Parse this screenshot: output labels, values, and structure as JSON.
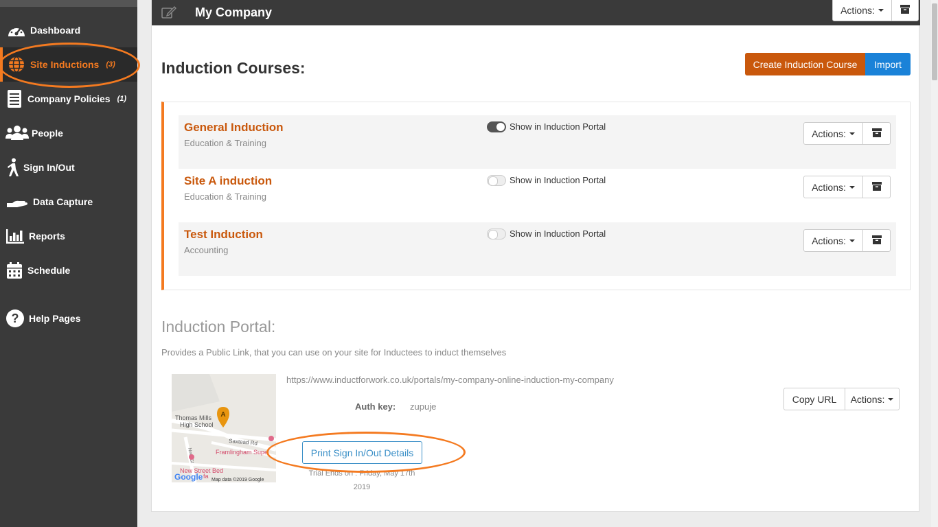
{
  "sidebar": {
    "items": [
      {
        "label": "Dashboard",
        "icon": "dashboard-icon"
      },
      {
        "label": "Site Inductions",
        "count": "(3)",
        "icon": "globe-icon"
      },
      {
        "label": "Company Policies",
        "count": "(1)",
        "icon": "document-icon"
      },
      {
        "label": "People",
        "icon": "people-icon"
      },
      {
        "label": "Sign In/Out",
        "icon": "walking-person-icon"
      },
      {
        "label": "Data Capture",
        "icon": "hand-icon"
      },
      {
        "label": "Reports",
        "icon": "bar-chart-icon"
      },
      {
        "label": "Schedule",
        "icon": "calendar-icon"
      },
      {
        "label": "Help Pages",
        "icon": "question-circle-icon"
      }
    ]
  },
  "header": {
    "title": "My Company",
    "actions_label": "Actions:"
  },
  "courses": {
    "title": "Induction Courses:",
    "create_label": "Create Induction Course",
    "import_label": "Import",
    "toggle_label": "Show in Induction Portal",
    "actions_label": "Actions:",
    "items": [
      {
        "name": "General Induction",
        "category": "Education & Training",
        "portal_on": true
      },
      {
        "name": "Site A induction",
        "category": "Education & Training",
        "portal_on": false
      },
      {
        "name": "Test Induction",
        "category": "Accounting",
        "portal_on": false
      }
    ]
  },
  "portal": {
    "title": "Induction Portal:",
    "description": "Provides a Public Link, that you can use on your site for Inductees to induct themselves",
    "url": "https://www.inductforwork.co.uk/portals/my-company-online-induction-my-company",
    "auth_label": "Auth key:",
    "auth_value": "zupuje",
    "copy_label": "Copy URL",
    "actions_label": "Actions:",
    "print_label": "Print Sign In/Out Details",
    "trial_line1": "Trial Ends on : Friday, May 17th",
    "trial_line2": "2019"
  },
  "map": {
    "marker": "A",
    "labels": [
      "Thomas Mills",
      "High School",
      "Saxtead Rd",
      "New St",
      "Framlingham Supe",
      "New Street Bed",
      "fa"
    ],
    "logo": "Google",
    "attribution": "Map data ©2019 Google"
  },
  "colors": {
    "sidebar_bg": "#3a3a3a",
    "accent_orange": "#f47a20",
    "course_title": "#c9580c",
    "import_blue": "#1a82d8",
    "link_blue": "#3a8fc7"
  }
}
